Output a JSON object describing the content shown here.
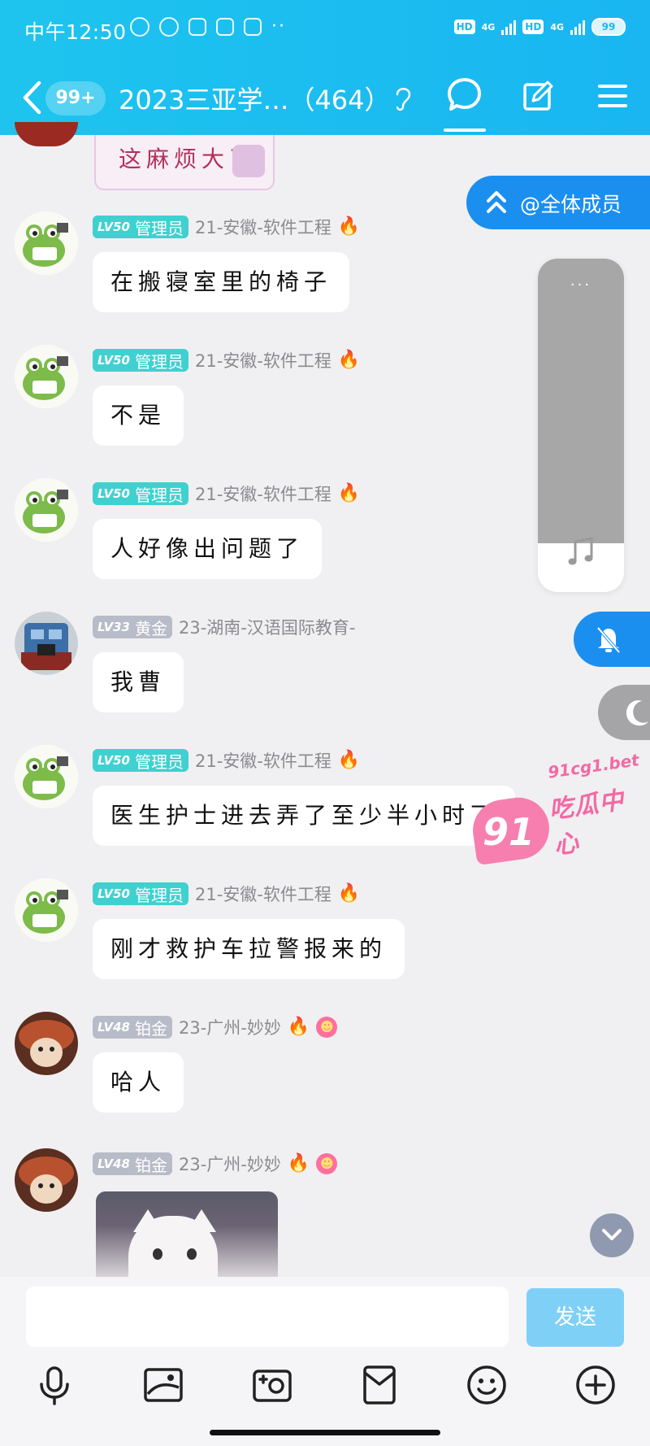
{
  "status_bar": {
    "time": "中午12:50",
    "dots": "··",
    "hd1": "HD",
    "net1": "4G",
    "hd2": "HD",
    "net2": "4G",
    "battery": "99"
  },
  "header": {
    "unread_badge": "99+",
    "title": "2023三亚学…（464）"
  },
  "top_sticker": {
    "text": "这麻烦大了"
  },
  "float": {
    "at_all_label": "@全体成员",
    "panel_dots": "···"
  },
  "messages": [
    {
      "level": "LV50",
      "rank": "管理员",
      "nick": "21-安徽-软件工程",
      "text": "在搬寝室里的椅子"
    },
    {
      "level": "LV50",
      "rank": "管理员",
      "nick": "21-安徽-软件工程",
      "text": "不是"
    },
    {
      "level": "LV50",
      "rank": "管理员",
      "nick": "21-安徽-软件工程",
      "text": "人好像出问题了"
    },
    {
      "level": "LV33",
      "rank": "黄金",
      "nick": "23-湖南-汉语国际教育-",
      "text": "我曹"
    },
    {
      "level": "LV50",
      "rank": "管理员",
      "nick": "21-安徽-软件工程",
      "text": "医生护士进去弄了至少半小时了"
    },
    {
      "level": "LV50",
      "rank": "管理员",
      "nick": "21-安徽-软件工程",
      "text": "刚才救护车拉警报来的"
    },
    {
      "level": "LV48",
      "rank": "铂金",
      "nick": "23-广州-妙妙",
      "text": "哈人"
    },
    {
      "level": "LV48",
      "rank": "铂金",
      "nick": "23-广州-妙妙",
      "text": ""
    }
  ],
  "watermark": {
    "num": "91",
    "url": "91cg1.bet",
    "cn": "吃瓜中心"
  },
  "input": {
    "send_label": "发送",
    "placeholder": ""
  },
  "colors": {
    "header": "#19b6f2",
    "accent": "#1b8ff0",
    "admin_badge": "#3fd1d0",
    "send_disabled": "#7fd0f7"
  },
  "toolbar_icons": [
    "mic-icon",
    "image-icon",
    "camera-icon",
    "red-packet-icon",
    "emoji-icon",
    "plus-icon"
  ]
}
